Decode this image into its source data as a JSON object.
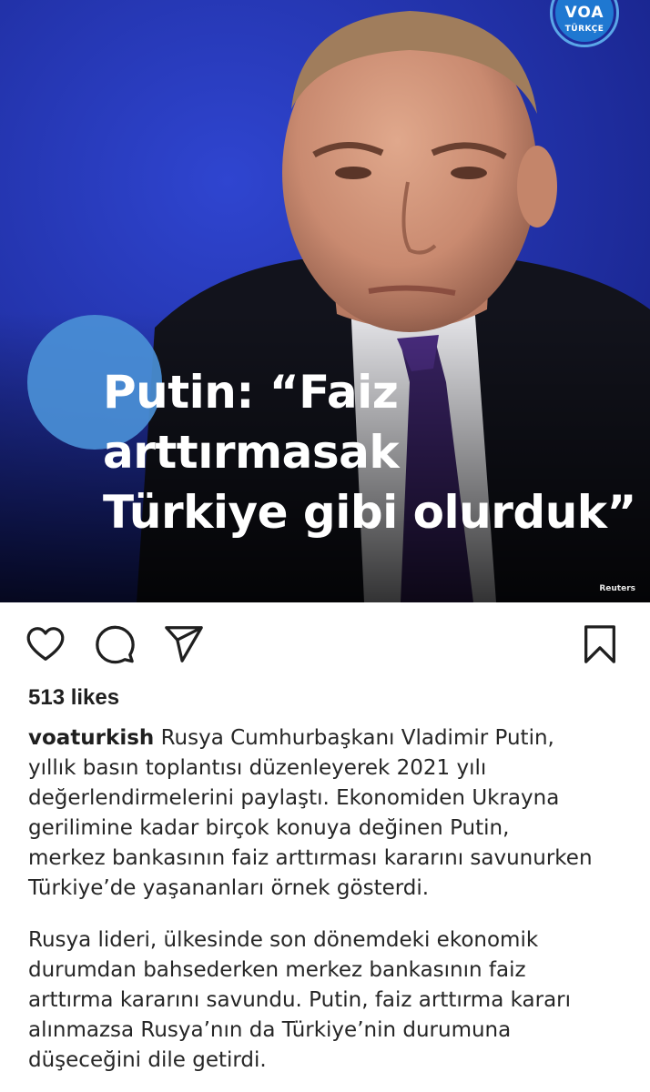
{
  "post": {
    "image": {
      "headline_lines": [
        "Putin: “Faiz",
        "arttırmasak",
        "Türkiye gibi olurduk”"
      ],
      "logo_text": "VOA",
      "logo_subtext": "TÜRKÇE",
      "photo_credit": "Reuters",
      "colors": {
        "background_blue": "#2436b8",
        "accent_circle": "#4a8fd6",
        "logo_blue": "#1f78d1"
      }
    },
    "actions": {
      "like_icon": "heart-outline",
      "comment_icon": "speech-bubble-outline",
      "share_icon": "paper-plane-outline",
      "save_icon": "bookmark-outline"
    },
    "likes_text": "513 likes",
    "username": "voaturkish",
    "caption_paragraph_1": {
      "first_line_rest": " Rusya Cumhurbaşkanı Vladimir Putin,",
      "lines": [
        "yıllık basın toplantısı düzenleyerek 2021 yılı",
        "değerlendirmelerini paylaştı. Ekonomiden Ukrayna",
        "gerilimine kadar birçok konuya değinen Putin,",
        "merkez bankasının faiz arttırması kararını savunurken",
        "Türkiye’de yaşananları örnek gösterdi."
      ]
    },
    "caption_paragraph_2": {
      "lines": [
        "Rusya lideri, ülkesinde son dönemdeki ekonomik",
        "durumdan bahsederken merkez bankasının faiz",
        "arttırma kararını savundu. Putin, faiz arttırma kararı",
        "alınmazsa Rusya’nın da Türkiye’nin durumuna",
        "düşeceğini dile getirdi."
      ]
    }
  }
}
